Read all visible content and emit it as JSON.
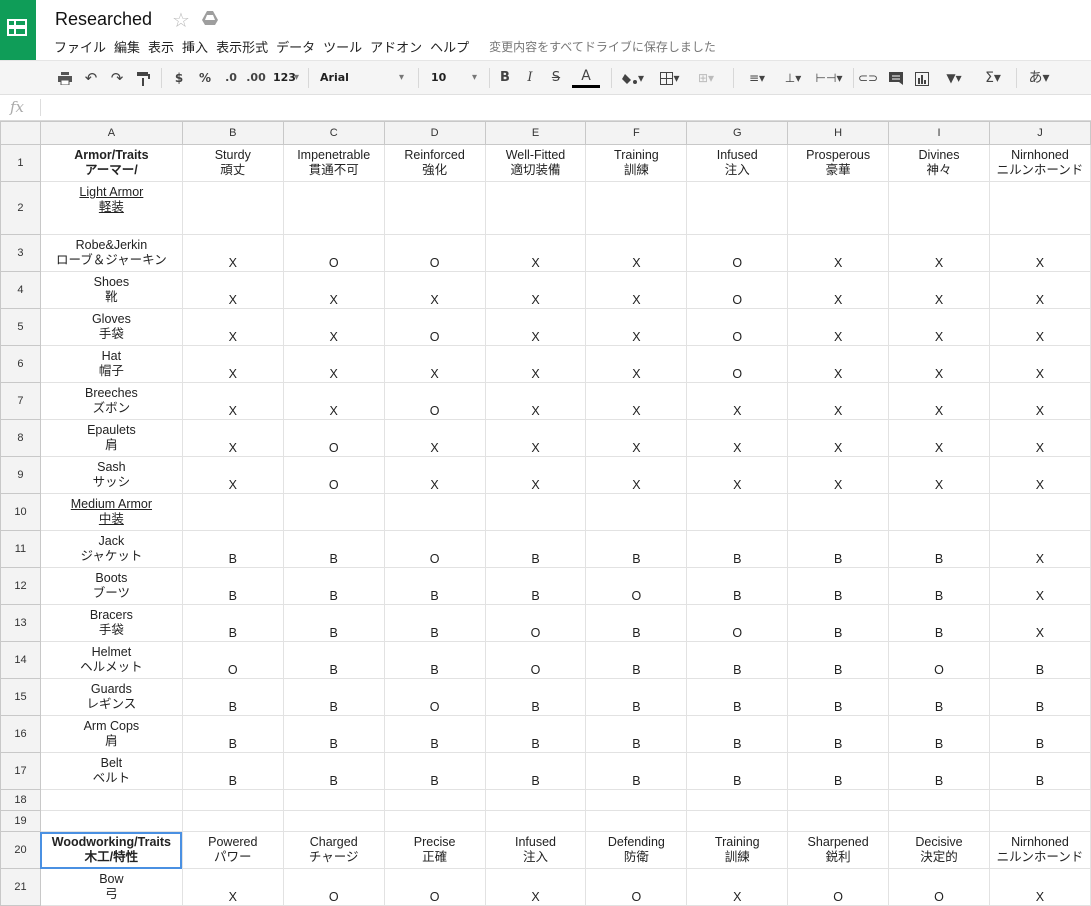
{
  "app": {
    "title": "Researched",
    "save_status": "変更内容をすべてドライブに保存しました",
    "menu": [
      "ファイル",
      "編集",
      "表示",
      "挿入",
      "表示形式",
      "データ",
      "ツール",
      "アドオン",
      "ヘルプ"
    ]
  },
  "toolbar": {
    "currency": "$",
    "percent": "%",
    "dec_decrease": ".0",
    "dec_increase": ".00",
    "more_formats": "123",
    "font": "Arial",
    "font_size": "10",
    "bold": "B",
    "italic": "I",
    "strike": "S",
    "text_color": "A",
    "input_tools": "あ"
  },
  "formula_bar": {
    "fx": "fx",
    "value": ""
  },
  "columns": [
    "A",
    "B",
    "C",
    "D",
    "E",
    "F",
    "G",
    "H",
    "I",
    "J"
  ],
  "rows": [
    {
      "n": "1",
      "type": "header",
      "a": [
        "Armor/Traits",
        "アーマー/"
      ],
      "cells": [
        [
          "Sturdy",
          "頑丈"
        ],
        [
          "Impenetrable",
          "貫通不可"
        ],
        [
          "Reinforced",
          "強化"
        ],
        [
          "Well-Fitted",
          "適切装備"
        ],
        [
          "Training",
          "訓練"
        ],
        [
          "Infused",
          "注入"
        ],
        [
          "Prosperous",
          "豪華"
        ],
        [
          "Divines",
          "神々"
        ],
        [
          "Nirnhoned",
          "ニルンホーンド"
        ]
      ]
    },
    {
      "n": "2",
      "type": "section",
      "a": [
        "Light Armor",
        "軽装"
      ],
      "cells": []
    },
    {
      "n": "3",
      "type": "item",
      "a": [
        "Robe&Jerkin",
        "ローブ＆ジャーキン"
      ],
      "cells": [
        "X",
        "O",
        "O",
        "X",
        "X",
        "O",
        "X",
        "X",
        "X"
      ]
    },
    {
      "n": "4",
      "type": "item",
      "a": [
        "Shoes",
        "靴"
      ],
      "cells": [
        "X",
        "X",
        "X",
        "X",
        "X",
        "O",
        "X",
        "X",
        "X"
      ]
    },
    {
      "n": "5",
      "type": "item",
      "a": [
        "Gloves",
        "手袋"
      ],
      "cells": [
        "X",
        "X",
        "O",
        "X",
        "X",
        "O",
        "X",
        "X",
        "X"
      ]
    },
    {
      "n": "6",
      "type": "item",
      "a": [
        "Hat",
        "帽子"
      ],
      "cells": [
        "X",
        "X",
        "X",
        "X",
        "X",
        "O",
        "X",
        "X",
        "X"
      ]
    },
    {
      "n": "7",
      "type": "item",
      "a": [
        "Breeches",
        "ズボン"
      ],
      "cells": [
        "X",
        "X",
        "O",
        "X",
        "X",
        "X",
        "X",
        "X",
        "X"
      ]
    },
    {
      "n": "8",
      "type": "item",
      "a": [
        "Epaulets",
        "肩"
      ],
      "cells": [
        "X",
        "O",
        "X",
        "X",
        "X",
        "X",
        "X",
        "X",
        "X"
      ]
    },
    {
      "n": "9",
      "type": "item",
      "a": [
        "Sash",
        "サッシ"
      ],
      "cells": [
        "X",
        "O",
        "X",
        "X",
        "X",
        "X",
        "X",
        "X",
        "X"
      ]
    },
    {
      "n": "10",
      "type": "section",
      "a": [
        "Medium Armor",
        "中装"
      ],
      "cells": []
    },
    {
      "n": "11",
      "type": "item",
      "a": [
        "Jack",
        "ジャケット"
      ],
      "cells": [
        "B",
        "B",
        "O",
        "B",
        "B",
        "B",
        "B",
        "B",
        "X"
      ]
    },
    {
      "n": "12",
      "type": "item",
      "a": [
        "Boots",
        "ブーツ"
      ],
      "cells": [
        "B",
        "B",
        "B",
        "B",
        "O",
        "B",
        "B",
        "B",
        "X"
      ]
    },
    {
      "n": "13",
      "type": "item",
      "a": [
        "Bracers",
        "手袋"
      ],
      "cells": [
        "B",
        "B",
        "B",
        "O",
        "B",
        "O",
        "B",
        "B",
        "X"
      ]
    },
    {
      "n": "14",
      "type": "item",
      "a": [
        "Helmet",
        "ヘルメット"
      ],
      "cells": [
        "O",
        "B",
        "B",
        "O",
        "B",
        "B",
        "B",
        "O",
        "B"
      ]
    },
    {
      "n": "15",
      "type": "item",
      "a": [
        "Guards",
        "レギンス"
      ],
      "cells": [
        "B",
        "B",
        "O",
        "B",
        "B",
        "B",
        "B",
        "B",
        "B"
      ]
    },
    {
      "n": "16",
      "type": "item",
      "a": [
        "Arm Cops",
        "肩"
      ],
      "cells": [
        "B",
        "B",
        "B",
        "B",
        "B",
        "B",
        "B",
        "B",
        "B"
      ]
    },
    {
      "n": "17",
      "type": "item",
      "a": [
        "Belt",
        "ベルト"
      ],
      "cells": [
        "B",
        "B",
        "B",
        "B",
        "B",
        "B",
        "B",
        "B",
        "B"
      ]
    },
    {
      "n": "18",
      "type": "empty",
      "a": [
        "",
        ""
      ],
      "cells": []
    },
    {
      "n": "19",
      "type": "empty",
      "a": [
        "",
        ""
      ],
      "cells": []
    },
    {
      "n": "20",
      "type": "header",
      "a": [
        "Woodworking/Traits",
        "木工/特性"
      ],
      "cells": [
        [
          "Powered",
          "パワー"
        ],
        [
          "Charged",
          "チャージ"
        ],
        [
          "Precise",
          "正確"
        ],
        [
          "Infused",
          "注入"
        ],
        [
          "Defending",
          "防衛"
        ],
        [
          "Training",
          "訓練"
        ],
        [
          "Sharpened",
          "鋭利"
        ],
        [
          "Decisive",
          "決定的"
        ],
        [
          "Nirnhoned",
          "ニルンホーンド"
        ]
      ]
    },
    {
      "n": "21",
      "type": "item",
      "a": [
        "Bow",
        "弓"
      ],
      "cells": [
        "X",
        "O",
        "O",
        "X",
        "O",
        "X",
        "O",
        "O",
        "X"
      ]
    }
  ]
}
